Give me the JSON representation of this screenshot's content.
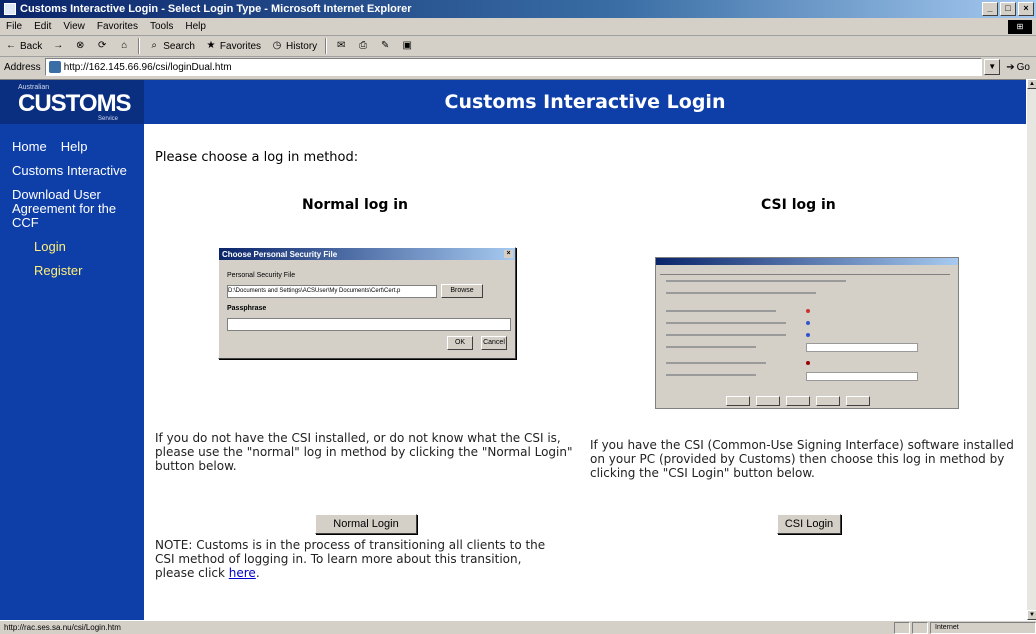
{
  "window": {
    "title": "Customs Interactive Login - Select Login Type - Microsoft Internet Explorer"
  },
  "menu": [
    "File",
    "Edit",
    "View",
    "Favorites",
    "Tools",
    "Help"
  ],
  "toolbar": {
    "back": "Back",
    "search": "Search",
    "favorites": "Favorites",
    "history": "History"
  },
  "address": {
    "label": "Address",
    "url": "http://162.145.66.96/csi/loginDual.htm",
    "go": "Go"
  },
  "logo": {
    "small": "Australian",
    "main": "CUSTOMS",
    "sub": "Service"
  },
  "banner": {
    "title": "Customs Interactive Login"
  },
  "sidebar": {
    "home": "Home",
    "help": "Help",
    "customs_interactive": "Customs Interactive",
    "download": "Download User Agreement for the CCF",
    "login": "Login",
    "register": "Register"
  },
  "main": {
    "prompt": "Please choose a log in method:",
    "normal": {
      "title": "Normal log in",
      "description": "If you do not have the CSI installed, or do not know what the CSI is, please use the \"normal\" log in method by clicking the \"Normal Login\" button below.",
      "button": "Normal Login"
    },
    "csi": {
      "title": "CSI log in",
      "description": "If you have the CSI (Common-Use Signing Interface) software installed on your PC (provided by Customs) then choose this log in method by clicking the \"CSI Login\" button below.",
      "button": "CSI Login"
    },
    "note": {
      "prefix": "NOTE:",
      "text": " Customs is in the process of transitioning all clients to the CSI method of logging in. To learn more about this transition, please click ",
      "link": "here",
      "suffix": "."
    }
  },
  "dialog": {
    "title": "Choose Personal Security File",
    "file_label": "Personal Security File",
    "file_value": "D:\\Documents and Settings\\ACSUser\\My Documents\\Cert\\Cert.p",
    "browse": "Browse",
    "password_label": "Passphrase",
    "ok": "OK",
    "cancel": "Cancel"
  },
  "status": {
    "text": "http://rac.ses.sa.nu/csi/Login.htm",
    "zone": "Internet"
  }
}
